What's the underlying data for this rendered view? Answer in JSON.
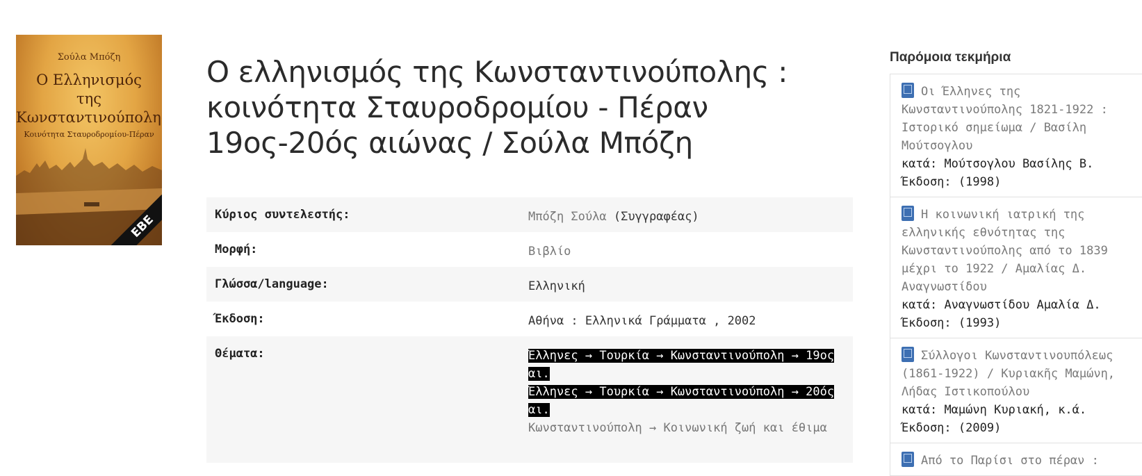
{
  "cover": {
    "author": "Σούλα Μπόζη",
    "title_lines": [
      "Ο Ελληνισμός",
      "της",
      "Κωνσταντινούπολης"
    ],
    "subtitle": "Κοινότητα Σταυροδρομίου-Πέραν",
    "publisher_mark": "ΕΒΕ"
  },
  "title": "Ο ελληνισμός της Κωνσταντινούπολης : κοινότητα Σταυροδρομίου - Πέραν 19ος-20ός αιώνας / Σούλα Μπόζη",
  "details": {
    "contributor": {
      "label": "Κύριος συντελεστής:",
      "name": "Μπόζη Σούλα",
      "role": "(Συγγραφέας)"
    },
    "format": {
      "label": "Μορφή:",
      "value": "Βιβλίο"
    },
    "language": {
      "label": "Γλώσσα/language:",
      "value": "Ελληνική"
    },
    "edition": {
      "label": "Έκδοση:",
      "value": "Αθήνα : Ελληνικά Γράμματα , 2002"
    },
    "subjects": {
      "label": "Θέματα:",
      "items": [
        "Έλληνες → Τουρκία → Κωνσταντινούπολη → 19ος αι.",
        "Έλληνες → Τουρκία → Κωνσταντινούπολη → 20ός αι.",
        "Κωνσταντινούπολη → Κοινωνική ζωή και έθιμα"
      ]
    }
  },
  "similar": {
    "heading": "Παρόμοια τεκμήρια",
    "by_label": "κατά:",
    "edition_label": "Έκδοση:",
    "items": [
      {
        "title": "Οι Έλληνες της Κωνσταντινούπολης 1821-1922 : Ιστορικό σημείωμα / Βασίλη Μούτσογλου",
        "author": "Μούτσογλου Βασίλης Β.",
        "year": "(1998)"
      },
      {
        "title": "Η κοινωνική ιατρική της ελληνικής εθνότητας της Κωνσταντινούπολης από το 1839 μέχρι το 1922 / Αμαλίας Δ. Αναγνωστίδου",
        "author": "Αναγνωστίδου Αμαλία Δ.",
        "year": "(1993)"
      },
      {
        "title": "Σύλλογοι Κωνσταντινουπόλεως (1861-1922) / Κυριακῆς Μαμώνη, Λήδας Ιστικοπούλου",
        "author": "Μαμώνη Κυριακή, κ.ά.",
        "year": "(2009)"
      },
      {
        "title": "Από το Παρίσι στο πέραν :"
      }
    ]
  }
}
